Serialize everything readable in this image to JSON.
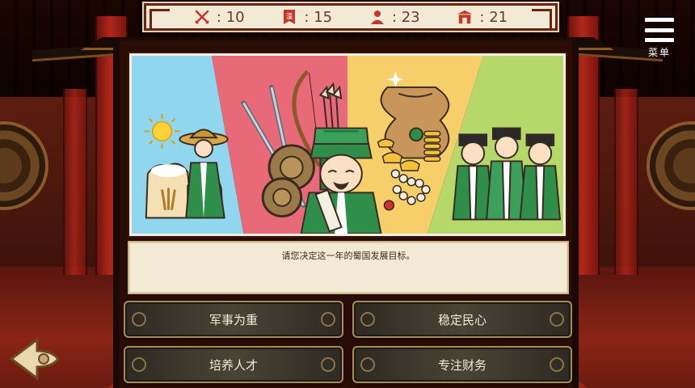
{
  "resources": [
    {
      "icon": "crossed-swords-icon",
      "value": "10"
    },
    {
      "icon": "han-banner-icon",
      "value": "15",
      "glyph": "漢"
    },
    {
      "icon": "person-icon",
      "value": "23"
    },
    {
      "icon": "gate-icon",
      "value": "21"
    }
  ],
  "menu": {
    "label": "菜单",
    "icon": "hamburger-menu-icon"
  },
  "prompt": {
    "text": "请您决定这一年的蜀国发展目标。"
  },
  "choices": {
    "military": "军事为重",
    "stabilize": "稳定民心",
    "talent": "培养人才",
    "finance": "专注财务"
  },
  "colors": {
    "accent": "#6b2114",
    "parchment": "#f3ead6",
    "button": "#3a362c",
    "panel_blue": "#8fd6ee",
    "panel_pink": "#e86a78",
    "panel_yellow": "#f6cf6a",
    "panel_green": "#b6d86a"
  }
}
